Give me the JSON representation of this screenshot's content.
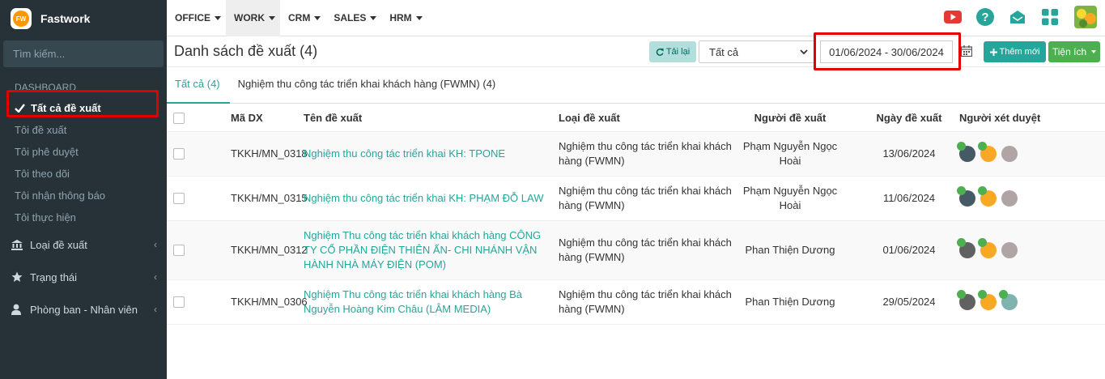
{
  "brand": {
    "logo_text": "FW",
    "name": "Fastwork"
  },
  "sidebar": {
    "search_placeholder": "Tìm kiếm...",
    "section_title": "DASHBOARD",
    "items": [
      {
        "label": "Tất cả đề xuất",
        "active": true
      },
      {
        "label": "Tôi đề xuất"
      },
      {
        "label": "Tôi phê duyệt"
      },
      {
        "label": "Tôi theo dõi"
      },
      {
        "label": "Tôi nhận thông báo"
      },
      {
        "label": "Tôi thực hiện"
      }
    ],
    "groups": [
      {
        "label": "Loại đề xuất",
        "icon": "bank-icon"
      },
      {
        "label": "Trạng thái",
        "icon": "star-icon"
      },
      {
        "label": "Phòng ban - Nhân viên",
        "icon": "user-icon"
      }
    ]
  },
  "topnav": {
    "items": [
      "OFFICE",
      "WORK",
      "CRM",
      "SALES",
      "HRM"
    ],
    "active": "WORK",
    "icons": [
      "youtube-icon",
      "help-icon",
      "mail-icon",
      "apps-icon"
    ]
  },
  "toolbar": {
    "title": "Danh sách đề xuất (4)",
    "reload_label": "Tải lại",
    "filter_value": "Tất cả",
    "date_range": "01/06/2024 - 30/06/2024",
    "add_label": "Thêm mới",
    "utility_label": "Tiện ích"
  },
  "tabs": [
    {
      "label": "Tất cả (4)",
      "active": true
    },
    {
      "label": "Nghiệm thu công tác triển khai khách hàng (FWMN) (4)"
    }
  ],
  "table": {
    "headers": {
      "code": "Mã DX",
      "name": "Tên đề xuất",
      "type": "Loại đề xuất",
      "person": "Người đề xuất",
      "date": "Ngày đề xuất",
      "reviewers": "Người xét duyệt"
    },
    "rows": [
      {
        "code": "TKKH/MN_0318",
        "name": "Nghiệm thu công tác triển khai KH: TPONE",
        "type": "Nghiệm thu công tác triển khai khách hàng (FWMN)",
        "person": "Phạm Nguyễn Ngọc Hoài",
        "date": "13/06/2024",
        "reviewers": [
          "#455a64",
          "#f9a825",
          "#b0a4a4"
        ]
      },
      {
        "code": "TKKH/MN_0315",
        "name": "Nghiệm thu công tác triển khai KH: PHẠM ĐỖ LAW",
        "type": "Nghiệm thu công tác triển khai khách hàng (FWMN)",
        "person": "Phạm Nguyễn Ngọc Hoài",
        "date": "11/06/2024",
        "reviewers": [
          "#455a64",
          "#f9a825",
          "#b0a4a4"
        ]
      },
      {
        "code": "TKKH/MN_0312",
        "name": "Nghiệm Thu công tác triển khai khách hàng CÔNG TY CỔ PHẦN ĐIỆN THIÊN ẤN- CHI NHÁNH VẬN HÀNH NHÀ MÁY ĐIỆN (POM)",
        "type": "Nghiệm thu công tác triển khai khách hàng (FWMN)",
        "person": "Phan Thiện Dương",
        "date": "01/06/2024",
        "reviewers": [
          "#616161",
          "#f9a825",
          "#b0a4a4"
        ]
      },
      {
        "code": "TKKH/MN_0306",
        "name": "Nghiệm Thu công tác triển khai khách hàng Bà Nguyễn Hoàng Kim Châu (LÂM MEDIA)",
        "type": "Nghiệm thu công tác triển khai khách hàng (FWMN)",
        "person": "Phan Thiện Dương",
        "date": "29/05/2024",
        "reviewers": [
          "#616161",
          "#f9a825",
          "#7fb3b0"
        ]
      }
    ]
  },
  "colors": {
    "accent": "#26a69a",
    "sidebar_bg": "#263238",
    "highlight": "#e00000",
    "youtube": "#e53935",
    "utility": "#4caf50"
  }
}
